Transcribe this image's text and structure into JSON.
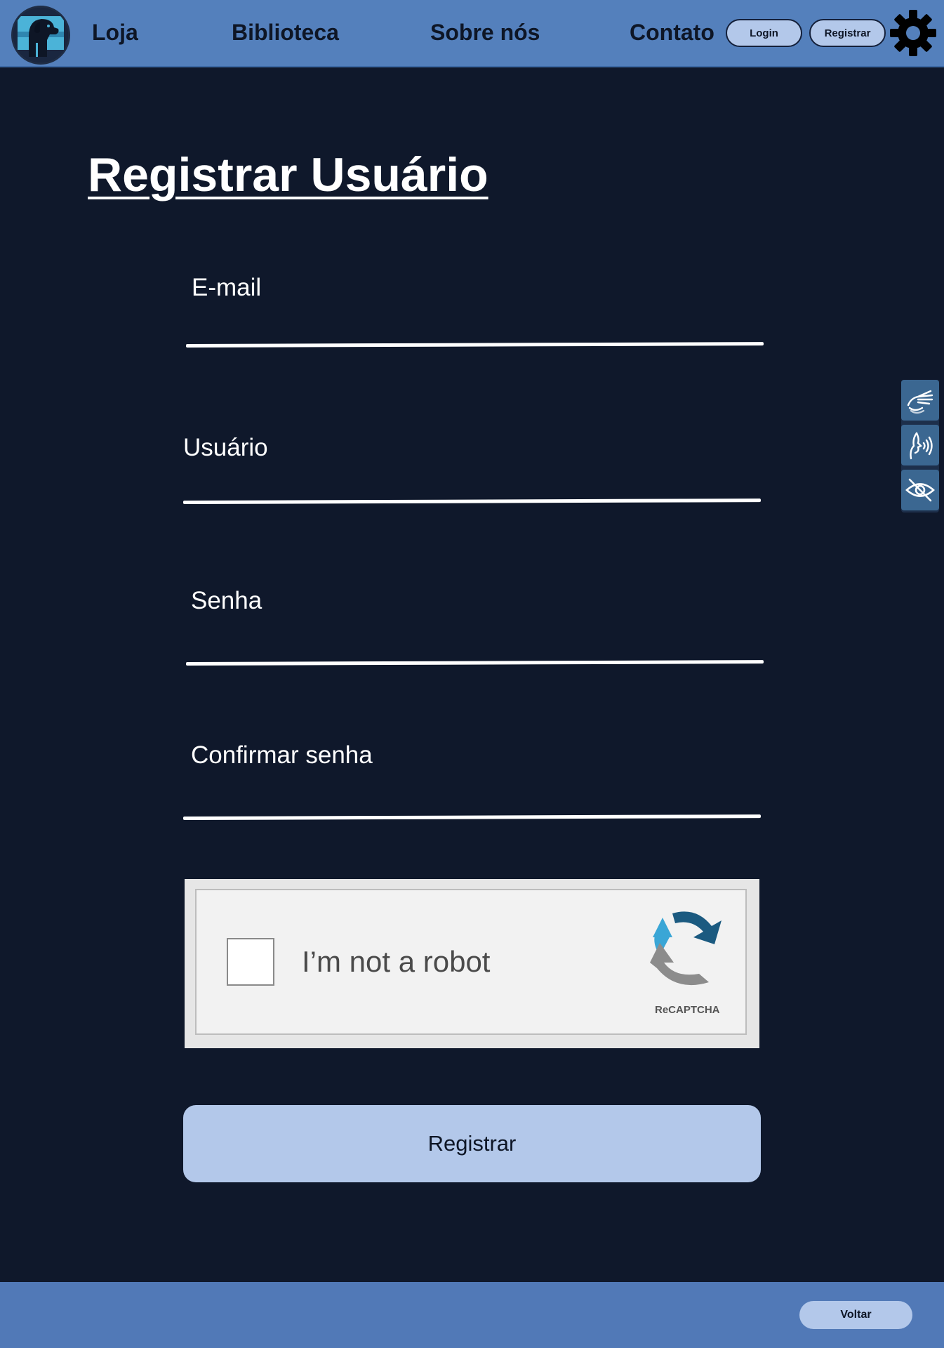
{
  "header": {
    "logo_alt": "dog-logo",
    "nav": [
      "Loja",
      "Biblioteca",
      "Sobre nós",
      "Contato"
    ],
    "login_label": "Login",
    "register_label": "Registrar",
    "settings_icon": "gear-icon"
  },
  "form": {
    "title": "Registrar Usuário",
    "fields": [
      {
        "label": "E-mail",
        "value": ""
      },
      {
        "label": "Usuário",
        "value": ""
      },
      {
        "label": "Senha",
        "value": ""
      },
      {
        "label": "Confirmar senha",
        "value": ""
      }
    ],
    "captcha": {
      "text": "I’m not a robot",
      "brand": "ReCAPTCHA",
      "checked": false
    },
    "submit_label": "Registrar"
  },
  "accessibility": {
    "icons": [
      "sign-language-icon",
      "audio-speech-icon",
      "low-vision-icon"
    ]
  },
  "footer": {
    "back_label": "Voltar"
  },
  "colors": {
    "background": "#0f182b",
    "header": "#5480bc",
    "footer": "#5179b7",
    "button": "#b3c8ea",
    "accessibility": "#3b6791"
  }
}
